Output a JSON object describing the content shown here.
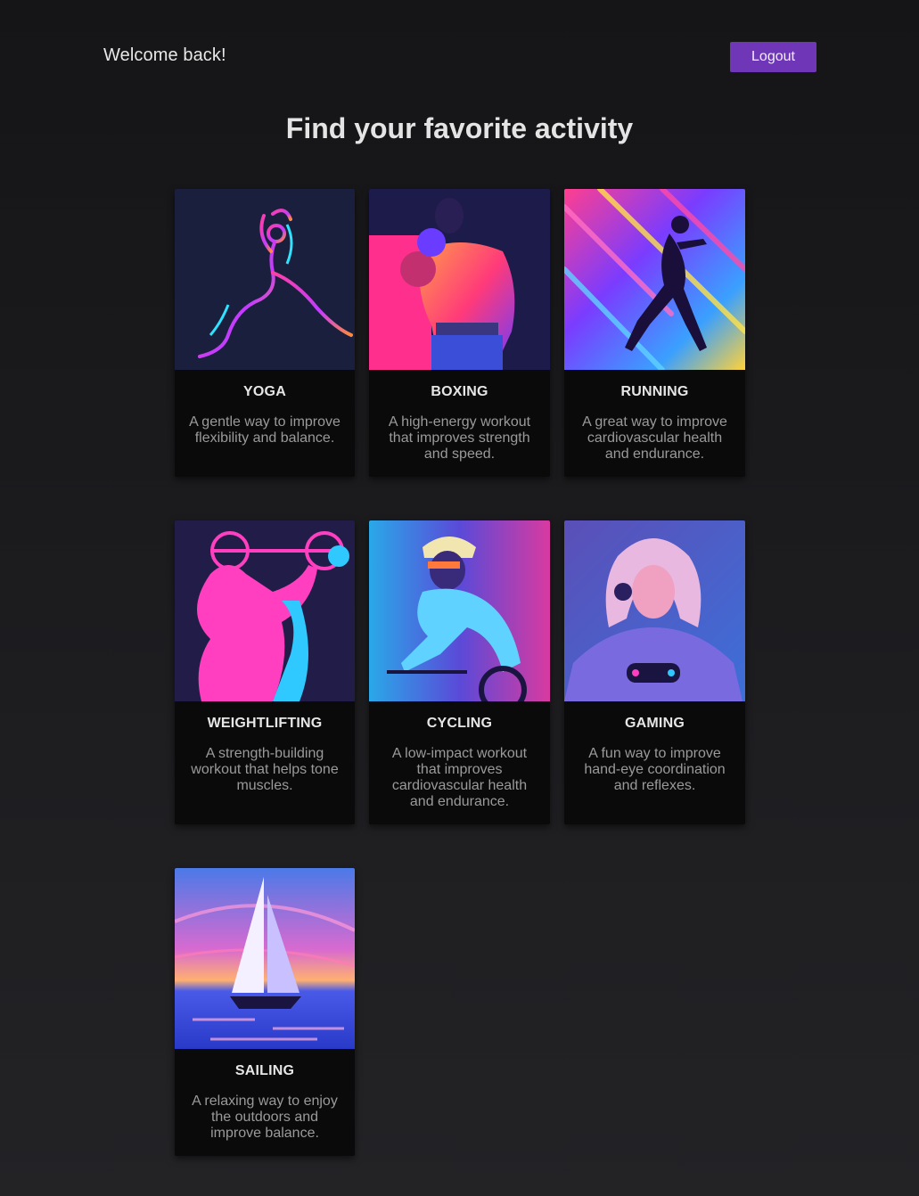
{
  "header": {
    "welcome_text": "Welcome back!",
    "logout_label": "Logout"
  },
  "main": {
    "title": "Find your favorite activity",
    "activities": [
      {
        "title": "YOGA",
        "description": "A gentle way to improve flexibility and balance.",
        "image_icon": "yoga-figure"
      },
      {
        "title": "BOXING",
        "description": "A high-energy workout that improves strength and speed.",
        "image_icon": "boxer-figure"
      },
      {
        "title": "RUNNING",
        "description": "A great way to improve cardiovascular health and endurance.",
        "image_icon": "runner-figure"
      },
      {
        "title": "WEIGHTLIFTING",
        "description": "A strength-building workout that helps tone muscles.",
        "image_icon": "weightlifter-figure"
      },
      {
        "title": "CYCLING",
        "description": "A low-impact workout that improves cardiovascular health and endurance.",
        "image_icon": "cyclist-figure"
      },
      {
        "title": "GAMING",
        "description": "A fun way to improve hand-eye coordination and reflexes.",
        "image_icon": "gamer-figure"
      },
      {
        "title": "SAILING",
        "description": "A relaxing way to enjoy the outdoors and improve balance.",
        "image_icon": "sailboat"
      }
    ]
  },
  "colors": {
    "accent": "#6f36b8",
    "background": "#1c1c1f",
    "card": "#0a0a0b"
  }
}
